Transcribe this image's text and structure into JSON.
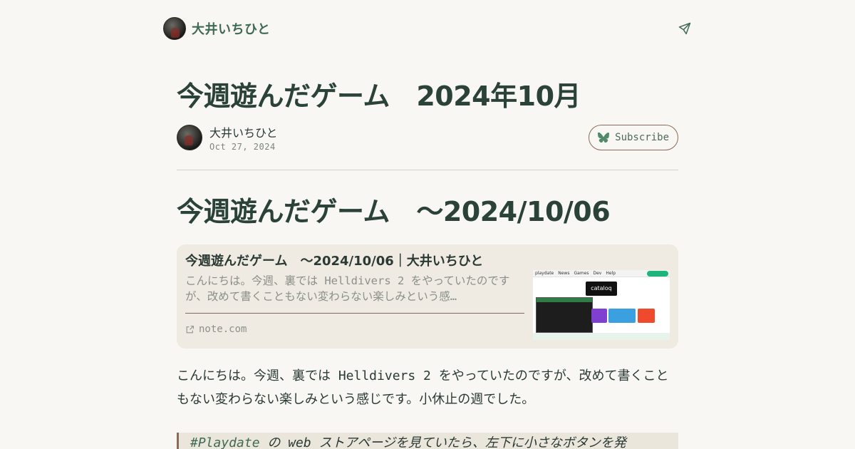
{
  "site": {
    "name": "大井いちひと"
  },
  "article": {
    "title": "今週遊んだゲーム　2024年10月",
    "author": "大井いちひと",
    "date": "Oct 27, 2024",
    "subscribe_label": "Subscribe",
    "heading": "今週遊んだゲーム　〜2024/10/06",
    "link_card": {
      "title": "今週遊んだゲーム　〜2024/10/06｜大井いちひと",
      "description": "こんにちは。今週、裏では Helldivers 2 をやっていたのですが、改めて書くこともない変わらない楽しみという感…",
      "domain": "note.com",
      "thumbnail_logo": "cataloq"
    },
    "paragraph": "こんにちは。今週、裏では Helldivers 2 をやっていたのですが、改めて書くこともない変わらない楽しみという感じです。小休止の週でした。",
    "quote": {
      "hashtag": "#Playdate",
      "text": " の web ストアページを見ていたら、左下に小さなボタンを発"
    }
  },
  "colors": {
    "background": "#f8f7f3",
    "brand_green": "#3f6a54",
    "heading": "#2a4238",
    "card_bg": "#efebe2",
    "subscribe_border": "#8a6a58"
  },
  "icons": {
    "send": "paper-plane-icon",
    "subscribe": "butterfly-icon",
    "external": "external-link-icon"
  }
}
